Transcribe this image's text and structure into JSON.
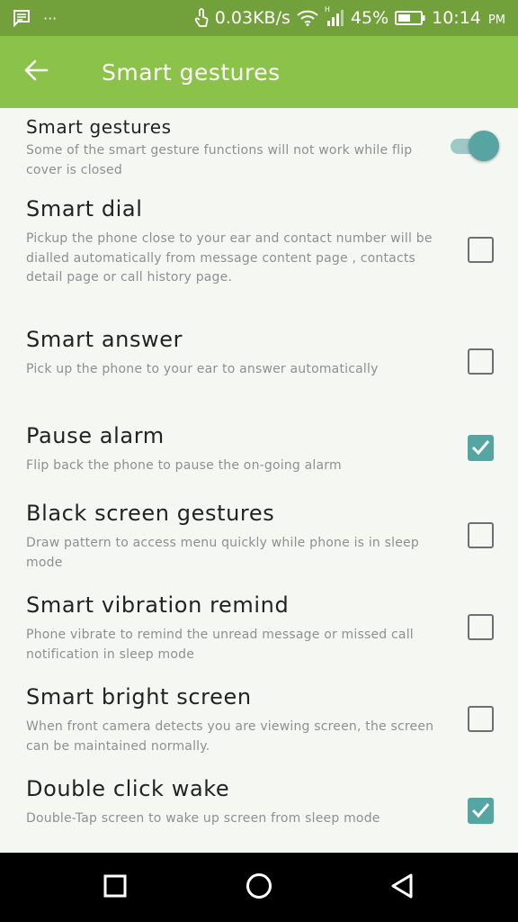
{
  "status_bar": {
    "notification_extra": "···",
    "speed": "0.03KB/s",
    "signal_type": "H",
    "battery": "45%",
    "time": "10:14",
    "ampm": "PM"
  },
  "app_bar": {
    "title": "Smart gestures",
    "back_icon": "arrow-left-icon"
  },
  "settings": {
    "master": {
      "title": "Smart gestures",
      "desc": "Some of the smart gesture functions will not work while flip cover is closed",
      "enabled": true
    },
    "items": [
      {
        "title": "Smart dial",
        "desc": "Pickup the phone close to your ear and contact number will be dialled automatically from message content page , contacts detail page or call history page.",
        "checked": false
      },
      {
        "title": "Smart answer",
        "desc": "Pick up the phone to your ear to answer automatically",
        "checked": false
      },
      {
        "title": "Pause alarm",
        "desc": "Flip back the phone to pause the on-going alarm",
        "checked": true
      },
      {
        "title": "Black screen gestures",
        "desc": "Draw pattern to access menu quickly while phone is in sleep mode",
        "checked": false
      },
      {
        "title": "Smart vibration remind",
        "desc": "Phone vibrate to remind the unread message or missed call notification in sleep mode",
        "checked": false
      },
      {
        "title": "Smart bright screen",
        "desc": "When front camera detects you are viewing screen, the screen can be maintained normally.",
        "checked": false
      },
      {
        "title": "Double click wake",
        "desc": "Double-Tap screen to wake up screen from sleep mode",
        "checked": true
      }
    ]
  },
  "colors": {
    "status_bar": "#72a03a",
    "app_bar": "#8bc34a",
    "accent": "#55a6a3",
    "background": "#f5f8f2"
  },
  "nav_bar": {
    "recents_icon": "square-icon",
    "home_icon": "circle-icon",
    "back_icon": "triangle-back-icon"
  }
}
